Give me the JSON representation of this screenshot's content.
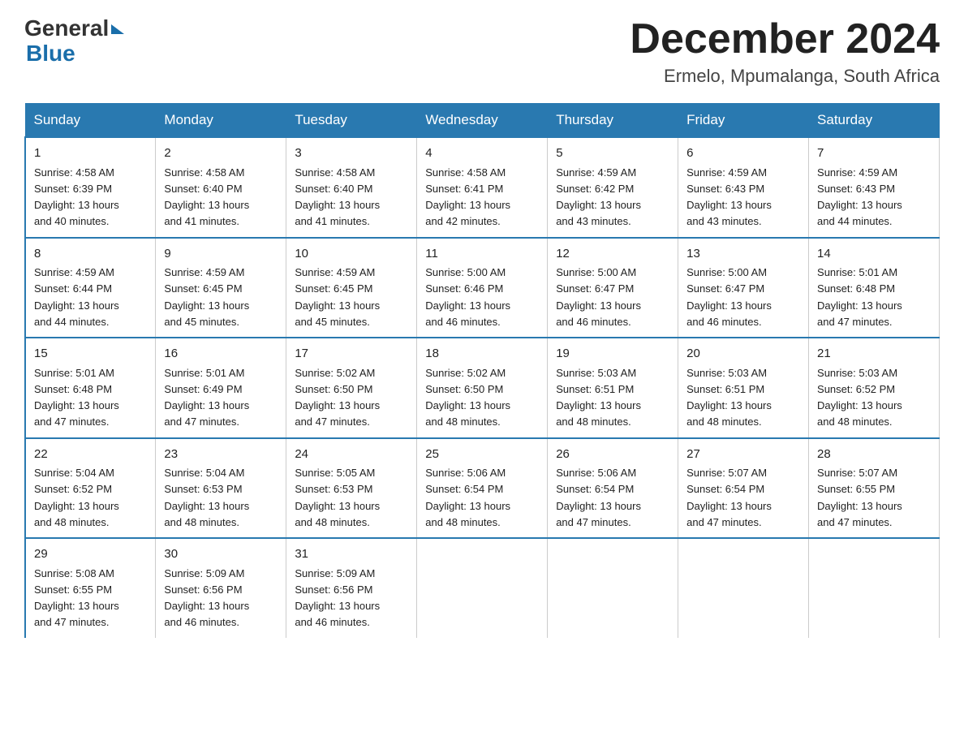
{
  "header": {
    "logo_general": "General",
    "logo_blue": "Blue",
    "month_title": "December 2024",
    "location": "Ermelo, Mpumalanga, South Africa"
  },
  "weekdays": [
    "Sunday",
    "Monday",
    "Tuesday",
    "Wednesday",
    "Thursday",
    "Friday",
    "Saturday"
  ],
  "weeks": [
    [
      {
        "day": "1",
        "sunrise": "4:58 AM",
        "sunset": "6:39 PM",
        "daylight": "13 hours and 40 minutes."
      },
      {
        "day": "2",
        "sunrise": "4:58 AM",
        "sunset": "6:40 PM",
        "daylight": "13 hours and 41 minutes."
      },
      {
        "day": "3",
        "sunrise": "4:58 AM",
        "sunset": "6:40 PM",
        "daylight": "13 hours and 41 minutes."
      },
      {
        "day": "4",
        "sunrise": "4:58 AM",
        "sunset": "6:41 PM",
        "daylight": "13 hours and 42 minutes."
      },
      {
        "day": "5",
        "sunrise": "4:59 AM",
        "sunset": "6:42 PM",
        "daylight": "13 hours and 43 minutes."
      },
      {
        "day": "6",
        "sunrise": "4:59 AM",
        "sunset": "6:43 PM",
        "daylight": "13 hours and 43 minutes."
      },
      {
        "day": "7",
        "sunrise": "4:59 AM",
        "sunset": "6:43 PM",
        "daylight": "13 hours and 44 minutes."
      }
    ],
    [
      {
        "day": "8",
        "sunrise": "4:59 AM",
        "sunset": "6:44 PM",
        "daylight": "13 hours and 44 minutes."
      },
      {
        "day": "9",
        "sunrise": "4:59 AM",
        "sunset": "6:45 PM",
        "daylight": "13 hours and 45 minutes."
      },
      {
        "day": "10",
        "sunrise": "4:59 AM",
        "sunset": "6:45 PM",
        "daylight": "13 hours and 45 minutes."
      },
      {
        "day": "11",
        "sunrise": "5:00 AM",
        "sunset": "6:46 PM",
        "daylight": "13 hours and 46 minutes."
      },
      {
        "day": "12",
        "sunrise": "5:00 AM",
        "sunset": "6:47 PM",
        "daylight": "13 hours and 46 minutes."
      },
      {
        "day": "13",
        "sunrise": "5:00 AM",
        "sunset": "6:47 PM",
        "daylight": "13 hours and 46 minutes."
      },
      {
        "day": "14",
        "sunrise": "5:01 AM",
        "sunset": "6:48 PM",
        "daylight": "13 hours and 47 minutes."
      }
    ],
    [
      {
        "day": "15",
        "sunrise": "5:01 AM",
        "sunset": "6:48 PM",
        "daylight": "13 hours and 47 minutes."
      },
      {
        "day": "16",
        "sunrise": "5:01 AM",
        "sunset": "6:49 PM",
        "daylight": "13 hours and 47 minutes."
      },
      {
        "day": "17",
        "sunrise": "5:02 AM",
        "sunset": "6:50 PM",
        "daylight": "13 hours and 47 minutes."
      },
      {
        "day": "18",
        "sunrise": "5:02 AM",
        "sunset": "6:50 PM",
        "daylight": "13 hours and 48 minutes."
      },
      {
        "day": "19",
        "sunrise": "5:03 AM",
        "sunset": "6:51 PM",
        "daylight": "13 hours and 48 minutes."
      },
      {
        "day": "20",
        "sunrise": "5:03 AM",
        "sunset": "6:51 PM",
        "daylight": "13 hours and 48 minutes."
      },
      {
        "day": "21",
        "sunrise": "5:03 AM",
        "sunset": "6:52 PM",
        "daylight": "13 hours and 48 minutes."
      }
    ],
    [
      {
        "day": "22",
        "sunrise": "5:04 AM",
        "sunset": "6:52 PM",
        "daylight": "13 hours and 48 minutes."
      },
      {
        "day": "23",
        "sunrise": "5:04 AM",
        "sunset": "6:53 PM",
        "daylight": "13 hours and 48 minutes."
      },
      {
        "day": "24",
        "sunrise": "5:05 AM",
        "sunset": "6:53 PM",
        "daylight": "13 hours and 48 minutes."
      },
      {
        "day": "25",
        "sunrise": "5:06 AM",
        "sunset": "6:54 PM",
        "daylight": "13 hours and 48 minutes."
      },
      {
        "day": "26",
        "sunrise": "5:06 AM",
        "sunset": "6:54 PM",
        "daylight": "13 hours and 47 minutes."
      },
      {
        "day": "27",
        "sunrise": "5:07 AM",
        "sunset": "6:54 PM",
        "daylight": "13 hours and 47 minutes."
      },
      {
        "day": "28",
        "sunrise": "5:07 AM",
        "sunset": "6:55 PM",
        "daylight": "13 hours and 47 minutes."
      }
    ],
    [
      {
        "day": "29",
        "sunrise": "5:08 AM",
        "sunset": "6:55 PM",
        "daylight": "13 hours and 47 minutes."
      },
      {
        "day": "30",
        "sunrise": "5:09 AM",
        "sunset": "6:56 PM",
        "daylight": "13 hours and 46 minutes."
      },
      {
        "day": "31",
        "sunrise": "5:09 AM",
        "sunset": "6:56 PM",
        "daylight": "13 hours and 46 minutes."
      },
      null,
      null,
      null,
      null
    ]
  ],
  "labels": {
    "sunrise": "Sunrise:",
    "sunset": "Sunset:",
    "daylight": "Daylight:"
  }
}
